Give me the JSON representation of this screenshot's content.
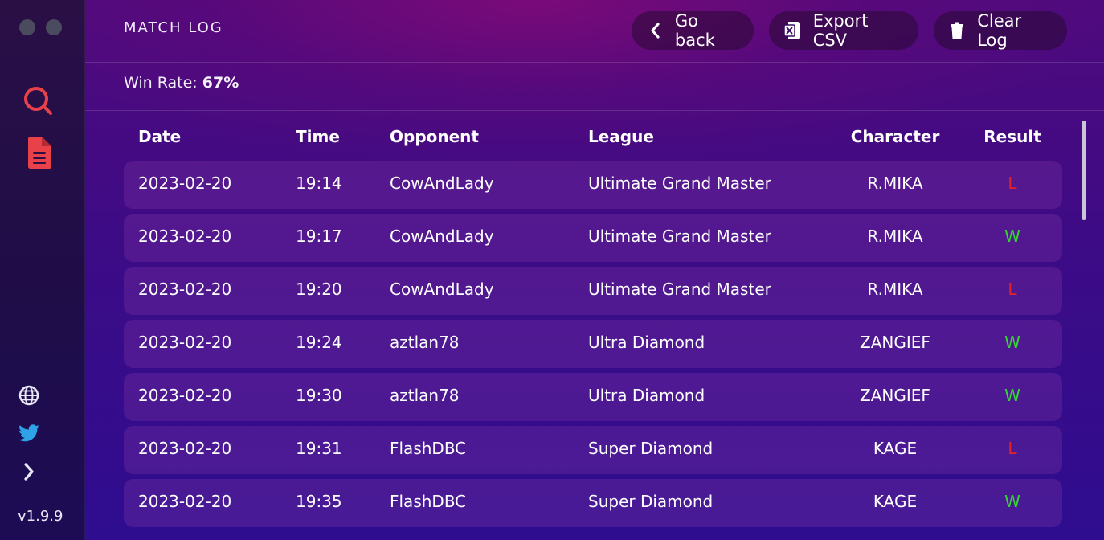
{
  "sidebar": {
    "version": "v1.9.9",
    "icons": [
      "search-icon",
      "document-icon",
      "globe-icon",
      "twitter-icon",
      "chevron-right-icon"
    ]
  },
  "header": {
    "title": "MATCH LOG",
    "buttons": {
      "back": "Go back",
      "export": "Export CSV",
      "clear": "Clear Log"
    }
  },
  "stats": {
    "win_rate_label": "Win Rate:",
    "win_rate_value": "67%"
  },
  "table": {
    "columns": [
      "Date",
      "Time",
      "Opponent",
      "League",
      "Character",
      "Result"
    ],
    "rows": [
      [
        "2023-02-20",
        "19:14",
        "CowAndLady",
        "Ultimate Grand Master",
        "R.MIKA",
        "L"
      ],
      [
        "2023-02-20",
        "19:17",
        "CowAndLady",
        "Ultimate Grand Master",
        "R.MIKA",
        "W"
      ],
      [
        "2023-02-20",
        "19:20",
        "CowAndLady",
        "Ultimate Grand Master",
        "R.MIKA",
        "L"
      ],
      [
        "2023-02-20",
        "19:24",
        "aztlan78",
        "Ultra Diamond",
        "ZANGIEF",
        "W"
      ],
      [
        "2023-02-20",
        "19:30",
        "aztlan78",
        "Ultra Diamond",
        "ZANGIEF",
        "W"
      ],
      [
        "2023-02-20",
        "19:31",
        "FlashDBC",
        "Super Diamond",
        "KAGE",
        "L"
      ],
      [
        "2023-02-20",
        "19:35",
        "FlashDBC",
        "Super Diamond",
        "KAGE",
        "W"
      ]
    ]
  },
  "colors": {
    "accent": "#e8414a",
    "win": "#33d633",
    "loss": "#e0242a",
    "twitter": "#2ea3e8"
  }
}
